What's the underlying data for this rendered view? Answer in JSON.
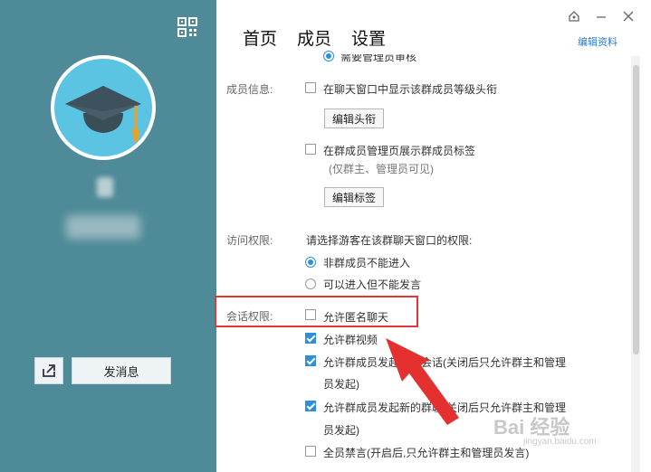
{
  "tabs": [
    "首页",
    "成员",
    "设置"
  ],
  "edit_profile": "编辑资料",
  "left": {
    "send_message": "发消息"
  },
  "settings": {
    "partial_top": "需要管理员审核",
    "member_info_label": "成员信息:",
    "show_level_title": "在聊天窗口中显示该群成员等级头衔",
    "edit_title_btn": "编辑头衔",
    "show_member_tag": "在群成员管理页展示群成员标签",
    "tag_note": "(仅群主、管理员可见)",
    "edit_tag_btn": "编辑标签",
    "visit_label": "访问权限:",
    "visit_desc": "请选择游客在该群聊天窗口的权限:",
    "visit_opt1": "非群成员不能进入",
    "visit_opt2": "可以进入但不能发言",
    "session_label": "会话权限:",
    "anon_chat": "允许匿名聊天",
    "group_video": "允许群视频",
    "temp_chat_line1": "允许群成员发起临时会话(关闭后只允许群主和管理",
    "temp_chat_line2": "员发起)",
    "new_group_line1": "允许群成员发起新的群聊(关闭后只允许群主和管理",
    "new_group_line2": "员发起)",
    "mute_all": "全员禁言(开启后,只允许群主和管理员发言)"
  },
  "watermark": {
    "main": "Bai 经验",
    "sub": "jingyan.baidu.com"
  },
  "colors": {
    "sidebar": "#4e8a97",
    "accent": "#2d8fde",
    "highlight": "#e33636",
    "arrow": "#e53030"
  }
}
